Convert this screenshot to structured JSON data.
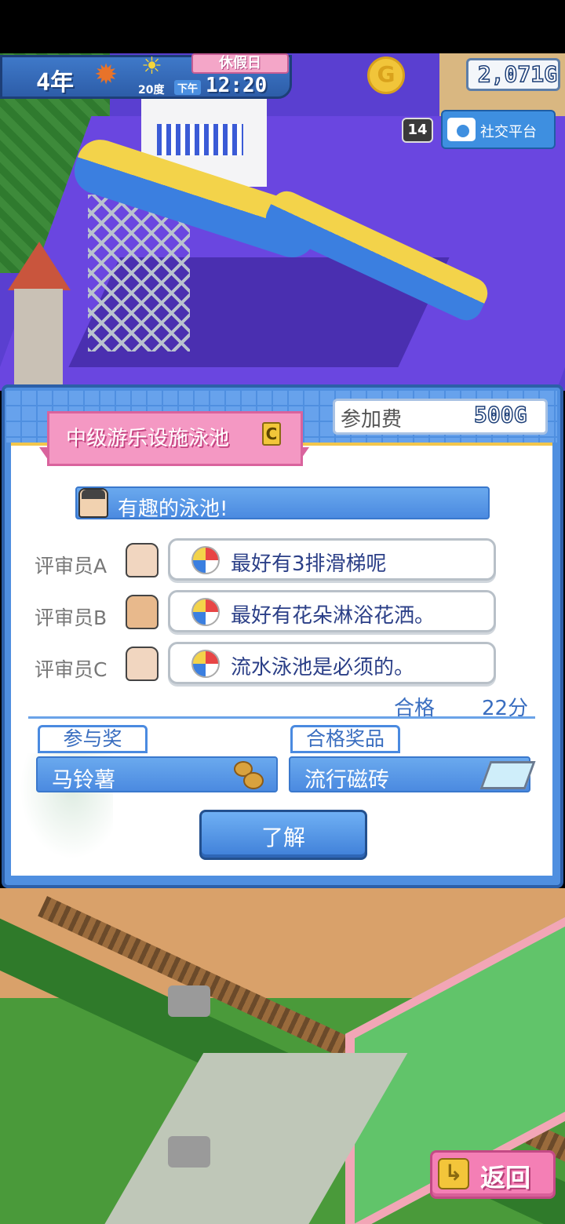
{
  "hud": {
    "year": "4年",
    "temperature": "20度",
    "period": "下午",
    "time": "12:20",
    "day_type": "休假日",
    "money": "2,071G",
    "social_count": "14",
    "social_label": "社交平台"
  },
  "dialog": {
    "title": "中级游乐设施泳池",
    "rank": "C",
    "fee_label": "参加费",
    "fee_value": "500G",
    "host_comment": "有趣的泳池!",
    "judges": [
      {
        "label": "评审员A",
        "comment": "最好有3排滑梯呢"
      },
      {
        "label": "评审员B",
        "comment": "最好有花朵淋浴花洒。"
      },
      {
        "label": "评审员C",
        "comment": "流水泳池是必须的。"
      }
    ],
    "result_label": "合格",
    "score": "22分",
    "participation_prize_label": "参与奖",
    "participation_prize_item": "马铃薯",
    "pass_prize_label": "合格奖品",
    "pass_prize_item": "流行磁砖",
    "ok_button": "了解"
  },
  "back_button": "返回",
  "colors": {
    "panel_blue": "#4f8fe0",
    "title_pink": "#f498c3",
    "judge_text": "#2b3f87",
    "back_pink": "#f47fb5"
  },
  "icons": [
    "maple-leaf-icon",
    "sun-icon",
    "coin-icon",
    "camera-icon",
    "beach-ball-icon",
    "potato-icon",
    "tile-icon",
    "back-arrow-icon"
  ]
}
